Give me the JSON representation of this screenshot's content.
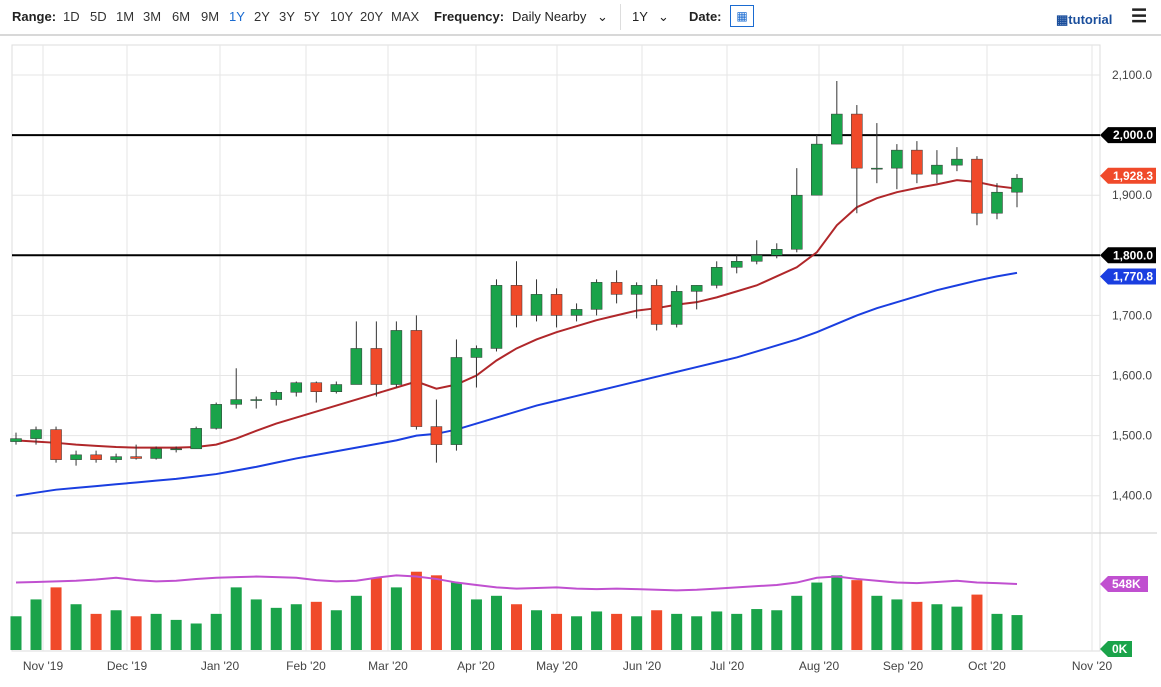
{
  "toolbar": {
    "range_label": "Range:",
    "ranges": [
      "1D",
      "5D",
      "1M",
      "3M",
      "6M",
      "9M",
      "1Y",
      "2Y",
      "3Y",
      "5Y",
      "10Y",
      "20Y",
      "MAX"
    ],
    "active_range": "1Y",
    "frequency_label": "Frequency:",
    "frequency_value": "Daily Nearby",
    "period_value": "1Y",
    "date_label": "Date:",
    "tutorial_label": "tutorial",
    "calendar_icon": "calendar-icon",
    "menu_icon": "hamburger-menu-icon"
  },
  "colors": {
    "up": "#1aa34a",
    "down": "#f04a2a",
    "ma50": "#b0272a",
    "ma200": "#1a3ee0",
    "vol_ma": "#c050d0",
    "hline": "#000000"
  },
  "chart_data": {
    "type": "candlestick",
    "x_ticks": [
      "Nov '19",
      "Dec '19",
      "Jan '20",
      "Feb '20",
      "Mar '20",
      "Apr '20",
      "May '20",
      "Jun '20",
      "Jul '20",
      "Aug '20",
      "Sep '20",
      "Oct '20",
      "Nov '20"
    ],
    "y_ticks": [
      "1,400.0",
      "1,500.0",
      "1,600.0",
      "1,700.0",
      "1,800.0",
      "1,900.0",
      "2,000.0",
      "2,100.0"
    ],
    "ylim": [
      1360,
      2125
    ],
    "grid": true,
    "horizontal_lines": [
      {
        "value": 2000,
        "label": "2,000.0"
      },
      {
        "value": 1800,
        "label": "1,800.0"
      }
    ],
    "last_price": {
      "value": 1928.3,
      "label": "1,928.3"
    },
    "ma200_last": {
      "value": 1770.8,
      "label": "1,770.8"
    },
    "candles_weekly": [
      [
        1490,
        1505,
        1485,
        1495
      ],
      [
        1495,
        1515,
        1485,
        1510
      ],
      [
        1510,
        1515,
        1455,
        1460
      ],
      [
        1460,
        1475,
        1450,
        1468
      ],
      [
        1468,
        1475,
        1455,
        1460
      ],
      [
        1460,
        1470,
        1455,
        1465
      ],
      [
        1465,
        1485,
        1460,
        1462
      ],
      [
        1462,
        1482,
        1460,
        1478
      ],
      [
        1478,
        1482,
        1472,
        1478
      ],
      [
        1478,
        1515,
        1478,
        1512
      ],
      [
        1512,
        1555,
        1510,
        1552
      ],
      [
        1552,
        1612,
        1545,
        1560
      ],
      [
        1560,
        1565,
        1545,
        1560
      ],
      [
        1560,
        1575,
        1550,
        1572
      ],
      [
        1572,
        1590,
        1565,
        1588
      ],
      [
        1588,
        1590,
        1555,
        1573
      ],
      [
        1573,
        1590,
        1570,
        1585
      ],
      [
        1585,
        1690,
        1585,
        1645
      ],
      [
        1645,
        1690,
        1565,
        1585
      ],
      [
        1585,
        1690,
        1580,
        1675
      ],
      [
        1675,
        1700,
        1510,
        1515
      ],
      [
        1515,
        1560,
        1455,
        1485
      ],
      [
        1485,
        1660,
        1475,
        1630
      ],
      [
        1630,
        1650,
        1580,
        1645
      ],
      [
        1645,
        1760,
        1640,
        1750
      ],
      [
        1750,
        1790,
        1680,
        1700
      ],
      [
        1700,
        1760,
        1690,
        1735
      ],
      [
        1735,
        1745,
        1680,
        1700
      ],
      [
        1700,
        1720,
        1690,
        1710
      ],
      [
        1710,
        1760,
        1700,
        1755
      ],
      [
        1755,
        1775,
        1720,
        1735
      ],
      [
        1735,
        1755,
        1695,
        1750
      ],
      [
        1750,
        1760,
        1675,
        1685
      ],
      [
        1685,
        1750,
        1680,
        1740
      ],
      [
        1740,
        1750,
        1710,
        1750
      ],
      [
        1750,
        1790,
        1745,
        1780
      ],
      [
        1780,
        1800,
        1770,
        1790
      ],
      [
        1790,
        1825,
        1785,
        1800
      ],
      [
        1800,
        1820,
        1795,
        1810
      ],
      [
        1810,
        1945,
        1805,
        1900
      ],
      [
        1900,
        2000,
        1900,
        1985
      ],
      [
        1985,
        2090,
        1985,
        2035
      ],
      [
        2035,
        2050,
        1870,
        1945
      ],
      [
        1945,
        2020,
        1920,
        1945
      ],
      [
        1945,
        1985,
        1910,
        1975
      ],
      [
        1975,
        1990,
        1920,
        1935
      ],
      [
        1935,
        1975,
        1920,
        1950
      ],
      [
        1950,
        1980,
        1940,
        1960
      ],
      [
        1960,
        1965,
        1850,
        1870
      ],
      [
        1870,
        1920,
        1860,
        1905
      ],
      [
        1905,
        1935,
        1880,
        1928.3
      ]
    ],
    "ma50_weekly": [
      1492,
      1490,
      1488,
      1485,
      1483,
      1481,
      1480,
      1480,
      1480,
      1481,
      1485,
      1495,
      1508,
      1520,
      1530,
      1540,
      1550,
      1560,
      1570,
      1580,
      1590,
      1578,
      1585,
      1600,
      1625,
      1645,
      1660,
      1672,
      1682,
      1692,
      1700,
      1708,
      1712,
      1718,
      1722,
      1730,
      1740,
      1750,
      1765,
      1780,
      1805,
      1850,
      1880,
      1895,
      1905,
      1912,
      1918,
      1925,
      1922,
      1915,
      1911
    ],
    "ma200_weekly": [
      1400,
      1405,
      1410,
      1413,
      1416,
      1419,
      1422,
      1425,
      1428,
      1432,
      1436,
      1442,
      1448,
      1455,
      1462,
      1468,
      1474,
      1480,
      1486,
      1492,
      1500,
      1503,
      1510,
      1520,
      1530,
      1540,
      1550,
      1558,
      1566,
      1574,
      1582,
      1590,
      1598,
      1606,
      1614,
      1622,
      1630,
      1640,
      1650,
      1660,
      1672,
      1686,
      1700,
      1712,
      1722,
      1732,
      1742,
      1750,
      1758,
      1765,
      1770.8
    ],
    "volume": {
      "last_label": "548K",
      "zero_label": "0K",
      "ylim_k": [
        0,
        900
      ],
      "values_k": [
        280,
        420,
        520,
        380,
        300,
        330,
        280,
        300,
        250,
        220,
        300,
        520,
        420,
        350,
        380,
        400,
        330,
        450,
        600,
        520,
        650,
        620,
        560,
        420,
        450,
        380,
        330,
        300,
        280,
        320,
        300,
        280,
        330,
        300,
        280,
        320,
        300,
        340,
        330,
        450,
        560,
        620,
        580,
        450,
        420,
        400,
        380,
        360,
        460,
        300,
        290
      ],
      "ma_k": [
        560,
        565,
        570,
        575,
        585,
        600,
        580,
        570,
        575,
        590,
        600,
        605,
        610,
        605,
        600,
        580,
        570,
        575,
        600,
        620,
        610,
        590,
        560,
        540,
        520,
        510,
        515,
        520,
        510,
        505,
        510,
        505,
        500,
        495,
        500,
        510,
        520,
        530,
        540,
        560,
        600,
        610,
        590,
        575,
        560,
        555,
        565,
        575,
        560,
        555,
        548
      ]
    }
  }
}
